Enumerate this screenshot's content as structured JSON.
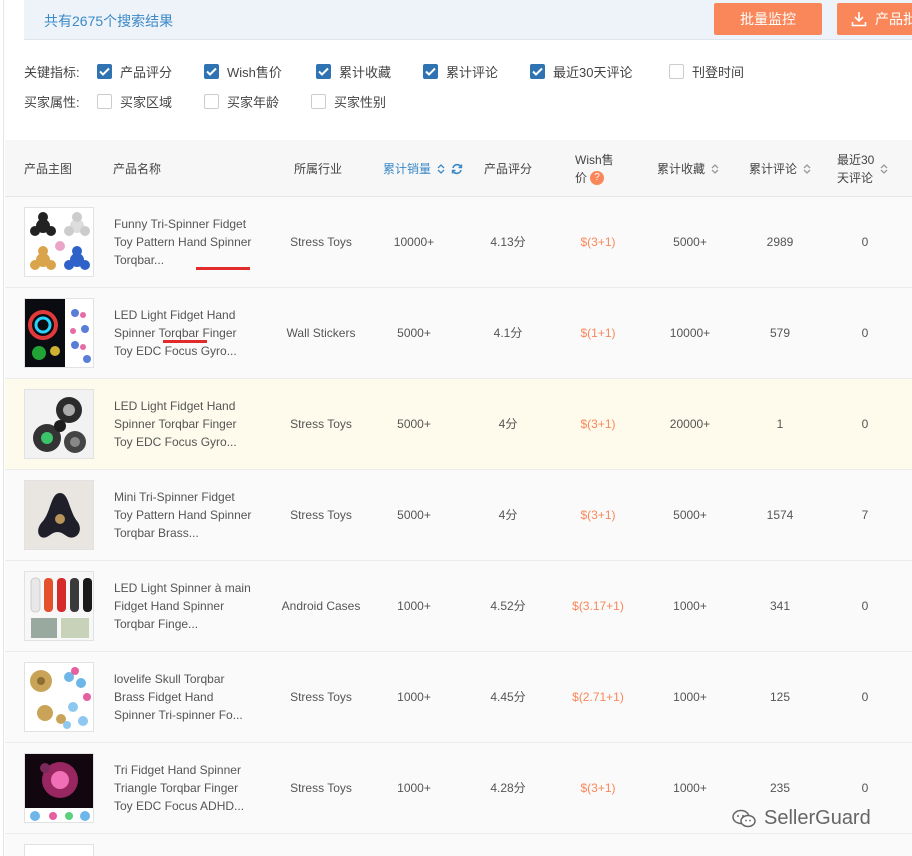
{
  "header": {
    "result_count": "共有2675个搜索结果",
    "monitor_button": "批量监控",
    "export_button": "产品批"
  },
  "filters": {
    "key_metrics_label": "关键指标:",
    "key_metrics": [
      {
        "label": "产品评分",
        "checked": true
      },
      {
        "label": "Wish售价",
        "checked": true
      },
      {
        "label": "累计收藏",
        "checked": true
      },
      {
        "label": "累计评论",
        "checked": true
      },
      {
        "label": "最近30天评论",
        "checked": true
      },
      {
        "label": "刊登时间",
        "checked": false
      }
    ],
    "buyer_attrs_label": "买家属性:",
    "buyer_attrs": [
      {
        "label": "买家区域",
        "checked": false
      },
      {
        "label": "买家年龄",
        "checked": false
      },
      {
        "label": "买家性别",
        "checked": false
      }
    ]
  },
  "table": {
    "columns": {
      "image": "产品主图",
      "name": "产品名称",
      "industry": "所属行业",
      "sales": "累计销量",
      "rating": "产品评分",
      "price_line1": "Wish售",
      "price_line2": "价",
      "favorites": "累计收藏",
      "reviews": "累计评论",
      "recent_line1": "最近30",
      "recent_line2": "天评论"
    },
    "rows": [
      {
        "name": "Funny Tri-Spinner Fidget Toy Pattern Hand Spinner Torqbar...",
        "industry": "Stress Toys",
        "sales": "10000+",
        "rating": "4.13分",
        "price": "$(3+1)",
        "favorites": "5000+",
        "reviews": "2989",
        "recent": "0"
      },
      {
        "name": "LED Light Fidget Hand Spinner Torqbar Finger Toy EDC Focus Gyro...",
        "industry": "Wall Stickers",
        "sales": "5000+",
        "rating": "4.1分",
        "price": "$(1+1)",
        "favorites": "10000+",
        "reviews": "579",
        "recent": "0"
      },
      {
        "name": "LED Light Fidget Hand Spinner Torqbar Finger Toy EDC Focus Gyro...",
        "industry": "Stress Toys",
        "sales": "5000+",
        "rating": "4分",
        "price": "$(3+1)",
        "favorites": "20000+",
        "reviews": "1",
        "recent": "0"
      },
      {
        "name": "Mini Tri-Spinner Fidget Toy Pattern Hand Spinner Torqbar Brass...",
        "industry": "Stress Toys",
        "sales": "5000+",
        "rating": "4分",
        "price": "$(3+1)",
        "favorites": "5000+",
        "reviews": "1574",
        "recent": "7"
      },
      {
        "name": "LED Light Spinner à main Fidget Hand Spinner Torqbar Finge...",
        "industry": "Android Cases",
        "sales": "1000+",
        "rating": "4.52分",
        "price": "$(3.17+1)",
        "favorites": "1000+",
        "reviews": "341",
        "recent": "0"
      },
      {
        "name": "lovelife Skull Torqbar Brass Fidget Hand Spinner Tri-spinner Fo...",
        "industry": "Stress Toys",
        "sales": "1000+",
        "rating": "4.45分",
        "price": "$(2.71+1)",
        "favorites": "1000+",
        "reviews": "125",
        "recent": "0"
      },
      {
        "name": "Tri Fidget Hand Spinner Triangle Torqbar Finger Toy EDC Focus ADHD...",
        "industry": "Stress Toys",
        "sales": "1000+",
        "rating": "4.28分",
        "price": "$(3+1)",
        "favorites": "1000+",
        "reviews": "235",
        "recent": "0"
      }
    ]
  },
  "watermark": "SellerGuard",
  "colors": {
    "accent": "#3b89c7",
    "button": "#f9875a",
    "checkbox": "#2f73b3",
    "highlight_row": "#fefbec"
  }
}
